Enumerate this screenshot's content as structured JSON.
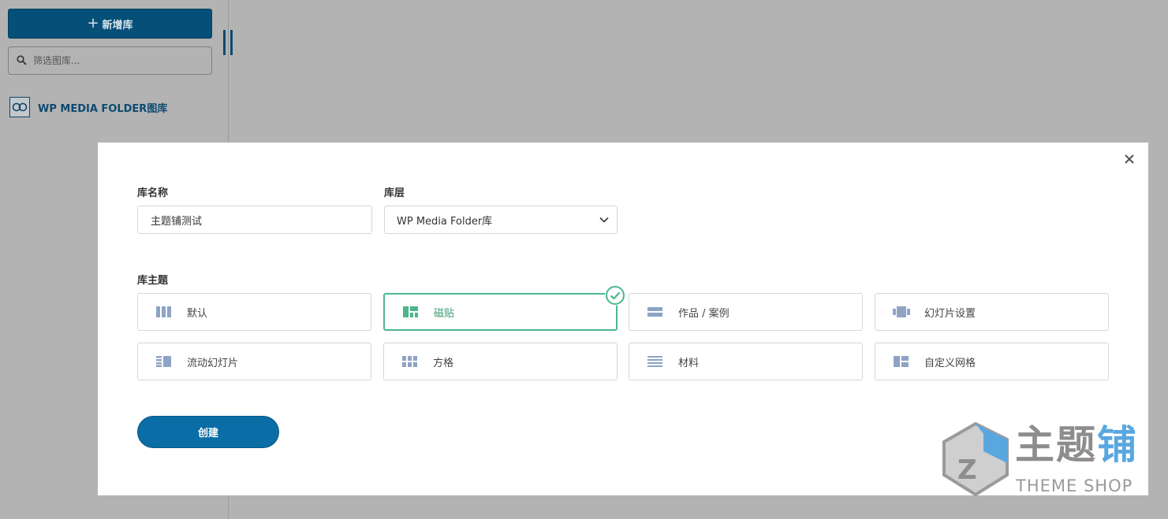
{
  "sidebar": {
    "add_button_label": "新增库",
    "filter_placeholder": "筛选图库...",
    "gallery_name": "WP MEDIA FOLDER图库"
  },
  "modal": {
    "name_label": "库名称",
    "name_value": "主题铺测试",
    "level_label": "库层",
    "level_value": "WP Media Folder库",
    "theme_label": "库主题",
    "themes": [
      {
        "label": "默认",
        "icon": "columns-icon",
        "selected": false
      },
      {
        "label": "磁贴",
        "icon": "masonry-icon",
        "selected": true
      },
      {
        "label": "作品 / 案例",
        "icon": "portfolio-icon",
        "selected": false
      },
      {
        "label": "幻灯片设置",
        "icon": "slider-icon",
        "selected": false
      },
      {
        "label": "流动幻灯片",
        "icon": "flow-slide-icon",
        "selected": false
      },
      {
        "label": "方格",
        "icon": "grid-icon",
        "selected": false
      },
      {
        "label": "材料",
        "icon": "list-icon",
        "selected": false
      },
      {
        "label": "自定义网格",
        "icon": "custom-grid-icon",
        "selected": false
      }
    ],
    "create_button_label": "创建"
  },
  "watermark": {
    "cn_text": "主题铺",
    "en_text": "THEME SHOP"
  },
  "colors": {
    "primary": "#054f78",
    "button": "#0a6da5",
    "selected_border": "#4cb68b",
    "icon_color": "#8ea3c6"
  }
}
